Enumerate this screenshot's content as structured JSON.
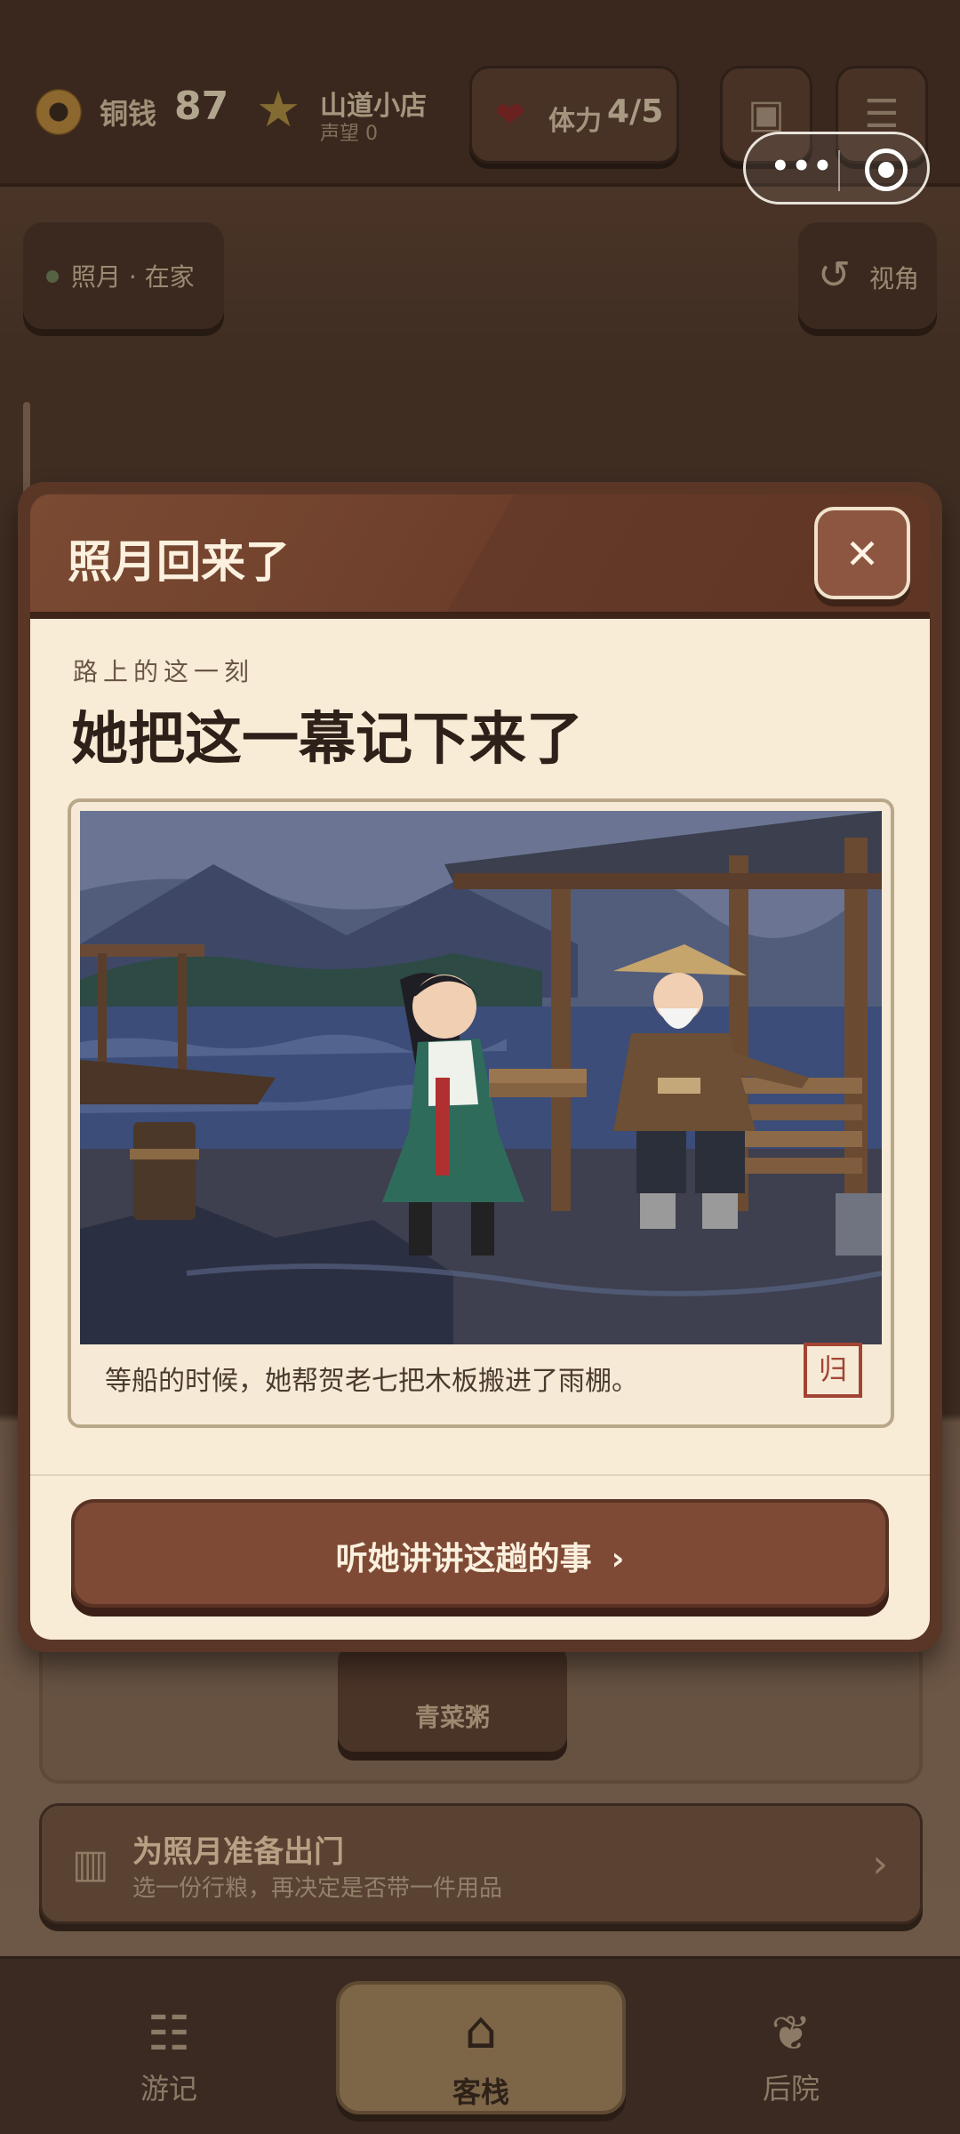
{
  "hud": {
    "coins_label": "铜钱",
    "coins_value": "87",
    "shop_name": "山道小店",
    "reputation": "声望 0",
    "stamina_label": "体力",
    "stamina_value": "4/5",
    "save_icon": "save-icon",
    "settings_icon": "sliders-icon"
  },
  "capsule": {
    "more": "•••",
    "close_icon": "target-icon"
  },
  "status": {
    "text": "照月 · 在家"
  },
  "view": {
    "label": "视角",
    "icon": "rotate-icon"
  },
  "modal": {
    "title": "照月回来了",
    "close_glyph": "✕",
    "subtitle": "路上的这一刻",
    "headline": "她把这一幕记下来了",
    "image_alt": "girl-and-old-man-at-rainy-dock-illustration",
    "caption": "等船的时候，她帮贺老七把木板搬进了雨棚。",
    "seal": "归",
    "cta_label": "听她讲讲这趟的事",
    "cta_chevron": "›"
  },
  "background": {
    "dish_label": "青菜粥",
    "prep_title": "为照月准备出门",
    "prep_subtitle": "选一份行粮，再决定是否带一件用品",
    "prep_chevron": "›"
  },
  "nav": {
    "items": [
      {
        "label": "游记",
        "icon": "journal-icon"
      },
      {
        "label": "客栈",
        "icon": "inn-icon"
      },
      {
        "label": "后院",
        "icon": "sprout-icon"
      }
    ],
    "active": "客栈"
  },
  "colors": {
    "modal_header": "#6d3f2b",
    "modal_body": "#f8ecd6",
    "cta": "#7e4a35",
    "seal": "#a24434"
  }
}
